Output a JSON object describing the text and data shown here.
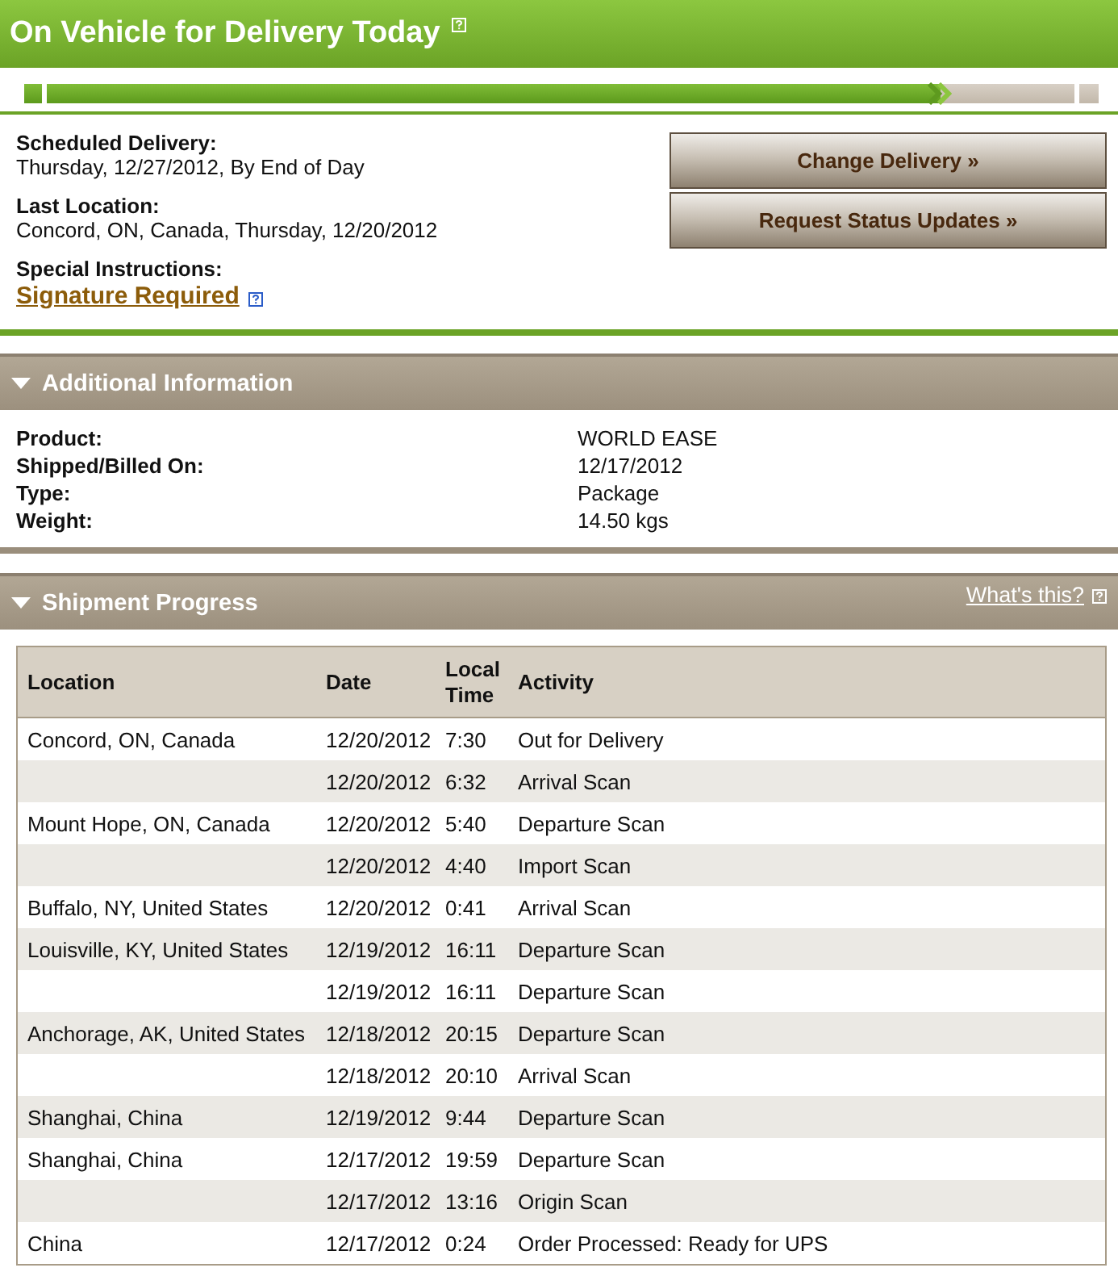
{
  "status": {
    "title": "On Vehicle for Delivery Today",
    "progress": {
      "level": 0.87
    }
  },
  "details": [
    {
      "kind": "text",
      "label": "Scheduled Delivery:",
      "value": "Thursday, 12/27/2012, By End of Day"
    },
    {
      "kind": "text",
      "label": "Last Location:",
      "value": "Concord, ON, Canada, Thursday, 12/20/2012"
    },
    {
      "kind": "link",
      "label": "Special Instructions:",
      "value": "Signature Required"
    }
  ],
  "actions": [
    "Change Delivery »",
    "Request Status Updates »"
  ],
  "additional_information": {
    "title": "Additional Information",
    "expanded": true,
    "rows": [
      {
        "label": "Product:",
        "value": "WORLD EASE"
      },
      {
        "label": "Shipped/Billed On:",
        "value": "12/17/2012"
      },
      {
        "label": "Type:",
        "value": "Package"
      },
      {
        "label": "Weight:",
        "value": "14.50 kgs"
      }
    ]
  },
  "shipment_progress": {
    "title": "Shipment Progress",
    "expanded": true,
    "help_link": "What's this?",
    "columns": [
      "Location",
      "Date",
      "Local Time",
      "Activity"
    ],
    "rows": [
      [
        "Concord, ON, Canada",
        "12/20/2012",
        "7:30",
        "Out for Delivery"
      ],
      [
        "",
        "12/20/2012",
        "6:32",
        "Arrival Scan"
      ],
      [
        "Mount Hope, ON, Canada",
        "12/20/2012",
        "5:40",
        "Departure Scan"
      ],
      [
        "",
        "12/20/2012",
        "4:40",
        "Import Scan"
      ],
      [
        "Buffalo, NY, United States",
        "12/20/2012",
        "0:41",
        "Arrival Scan"
      ],
      [
        "Louisville, KY, United States",
        "12/19/2012",
        "16:11",
        "Departure Scan"
      ],
      [
        "",
        "12/19/2012",
        "16:11",
        "Departure Scan"
      ],
      [
        "Anchorage, AK, United States",
        "12/18/2012",
        "20:15",
        "Departure Scan"
      ],
      [
        "",
        "12/18/2012",
        "20:10",
        "Arrival Scan"
      ],
      [
        "Shanghai, China",
        "12/19/2012",
        "9:44",
        "Departure Scan"
      ],
      [
        "Shanghai, China",
        "12/17/2012",
        "19:59",
        "Departure Scan"
      ],
      [
        "",
        "12/17/2012",
        "13:16",
        "Origin Scan"
      ],
      [
        "China",
        "12/17/2012",
        "0:24",
        "Order Processed: Ready for UPS"
      ]
    ]
  }
}
